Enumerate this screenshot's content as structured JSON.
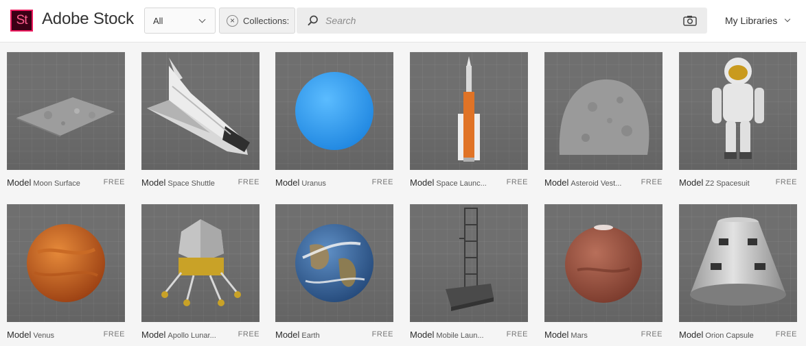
{
  "app": {
    "logo_text": "St",
    "name": "Adobe Stock"
  },
  "search": {
    "scope": "All",
    "chip_label": "Collections:",
    "placeholder": "Search"
  },
  "header_right": {
    "libraries_label": "My Libraries"
  },
  "icons": {
    "logo": "adobe-stock-logo",
    "dropdown": "chevron-down-icon",
    "remove_chip": "close-icon",
    "search": "search-icon",
    "visual_search": "camera-icon"
  },
  "results": [
    {
      "type": "Model",
      "name": "Moon Surface",
      "price": "FREE"
    },
    {
      "type": "Model",
      "name": "Space Shuttle",
      "price": "FREE"
    },
    {
      "type": "Model",
      "name": "Uranus",
      "price": "FREE"
    },
    {
      "type": "Model",
      "name": "Space Launc...",
      "price": "FREE"
    },
    {
      "type": "Model",
      "name": "Asteroid Vest...",
      "price": "FREE"
    },
    {
      "type": "Model",
      "name": "Z2 Spacesuit",
      "price": "FREE"
    },
    {
      "type": "Model",
      "name": "Venus",
      "price": "FREE"
    },
    {
      "type": "Model",
      "name": "Apollo Lunar...",
      "price": "FREE"
    },
    {
      "type": "Model",
      "name": "Earth",
      "price": "FREE"
    },
    {
      "type": "Model",
      "name": "Mobile Laun...",
      "price": "FREE"
    },
    {
      "type": "Model",
      "name": "Mars",
      "price": "FREE"
    },
    {
      "type": "Model",
      "name": "Orion Capsule",
      "price": "FREE"
    }
  ],
  "colors": {
    "brand": "#ec1a5e",
    "brand_dark": "#3a0015",
    "thumb_bg": "#6f6f6f"
  }
}
